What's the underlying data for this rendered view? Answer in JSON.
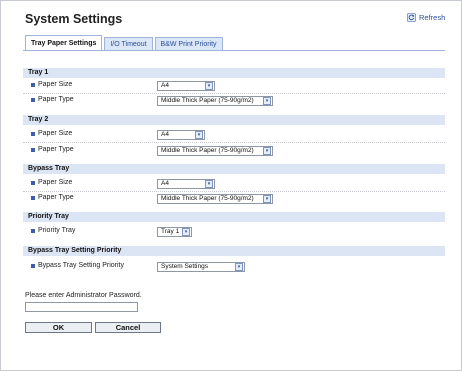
{
  "page_title": "System Settings",
  "refresh_label": "Refresh",
  "tabs": [
    {
      "label": "Tray Paper Settings",
      "active": true
    },
    {
      "label": "I/O Timeout",
      "active": false
    },
    {
      "label": "B&W Print Priority",
      "active": false
    }
  ],
  "sections": [
    {
      "title": "Tray 1",
      "rows": [
        {
          "label": "Paper Size",
          "value": "A4"
        },
        {
          "label": "Paper Type",
          "value": "Middle Thick Paper (75-90g/m2)"
        }
      ]
    },
    {
      "title": "Tray 2",
      "rows": [
        {
          "label": "Paper Size",
          "value": "A4"
        },
        {
          "label": "Paper Type",
          "value": "Middle Thick Paper (75-90g/m2)"
        }
      ]
    },
    {
      "title": "Bypass Tray",
      "rows": [
        {
          "label": "Paper Size",
          "value": "A4"
        },
        {
          "label": "Paper Type",
          "value": "Middle Thick Paper (75-90g/m2)"
        }
      ]
    },
    {
      "title": "Priority Tray",
      "rows": [
        {
          "label": "Priority Tray",
          "value": "Tray 1"
        }
      ]
    },
    {
      "title": "Bypass Tray Setting Priority",
      "rows": [
        {
          "label": "Bypass Tray Setting Priority",
          "value": "System Settings"
        }
      ]
    }
  ],
  "password": {
    "label": "Please enter Administrator Password.",
    "value": ""
  },
  "buttons": {
    "ok": "OK",
    "cancel": "Cancel"
  },
  "colors": {
    "accent": "#2a4f9a",
    "section_bg": "#dce5f3",
    "tab_bg": "#dbe6f6"
  }
}
